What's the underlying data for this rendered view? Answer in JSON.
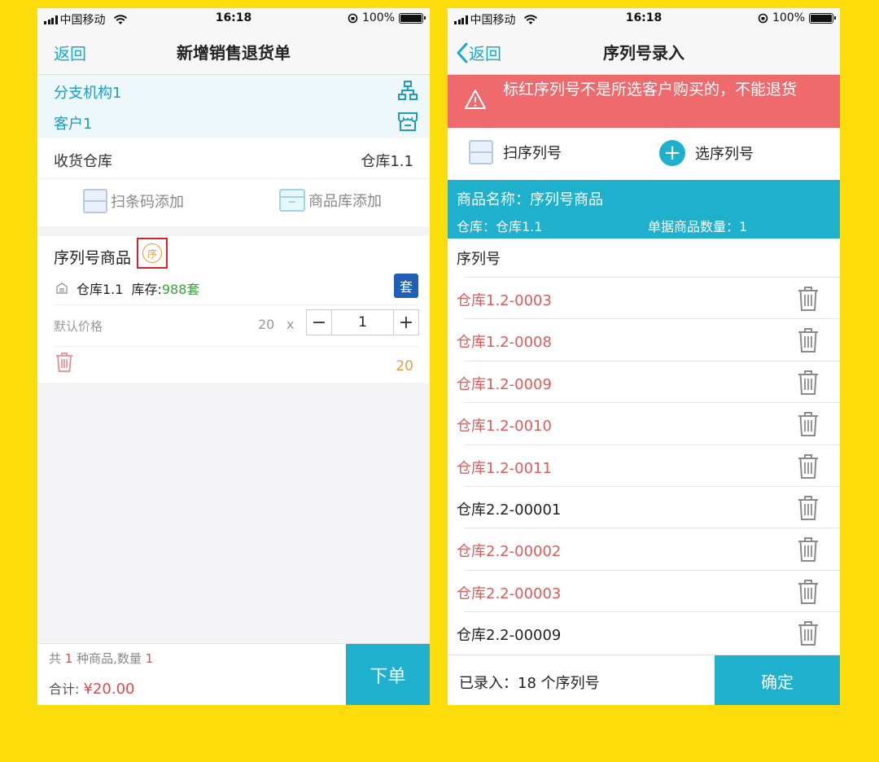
{
  "status_bar": {
    "carrier": "中国移动",
    "time": "16:18",
    "battery": "100%"
  },
  "left": {
    "nav": {
      "back_label": "返回",
      "title": "新增销售退货单"
    },
    "branch": "分支机构1",
    "customer": "客户1",
    "warehouse": {
      "label": "收货仓库",
      "value": "仓库1.1"
    },
    "add": {
      "scan_label": "扫条码添加",
      "catalog_label": "商品库添加"
    },
    "item": {
      "name": "序列号商品",
      "serial_badge": "序",
      "warehouse": "仓库1.1",
      "stock_label": "库存:",
      "stock_value": "988套",
      "set_button": "套",
      "price_label": "默认价格",
      "unit_price": "20",
      "times": "x",
      "quantity": "1",
      "subtotal": "20"
    },
    "footer": {
      "count_prefix": "共 ",
      "kinds": "1",
      "count_middle": " 种商品,数量 ",
      "quantity": "1",
      "total_label": "合计: ",
      "total_value": "¥20.00",
      "order_button": "下单"
    }
  },
  "right": {
    "nav": {
      "back_label": "返回",
      "title": "序列号录入"
    },
    "warning": "标红序列号不是所选客户购买的，不能退货",
    "scan_button": "扫序列号",
    "select_button": "选序列号",
    "product": {
      "name_label": "商品名称：序列号商品",
      "warehouse_label": "仓库：仓库1.1",
      "quantity_label": "单据商品数量：1"
    },
    "list_header": "序列号",
    "serials": [
      {
        "code": "仓库1.2-0003",
        "invalid": true
      },
      {
        "code": "仓库1.2-0008",
        "invalid": true
      },
      {
        "code": "仓库1.2-0009",
        "invalid": true
      },
      {
        "code": "仓库1.2-0010",
        "invalid": true
      },
      {
        "code": "仓库1.2-0011",
        "invalid": true
      },
      {
        "code": "仓库2.2-00001",
        "invalid": false
      },
      {
        "code": "仓库2.2-00002",
        "invalid": true
      },
      {
        "code": "仓库2.2-00003",
        "invalid": true
      },
      {
        "code": "仓库2.2-00009",
        "invalid": false
      }
    ],
    "footer": {
      "recorded": "已录入：18 个序列号",
      "confirm_button": "确定"
    }
  },
  "colors": {
    "background": "#FDDC0B",
    "accent": "#1fb0cd",
    "warning": "#ef6a6d",
    "invalid_serial": "#e05a5a",
    "badge": "#e89a3c",
    "stock": "#3aa43a"
  }
}
